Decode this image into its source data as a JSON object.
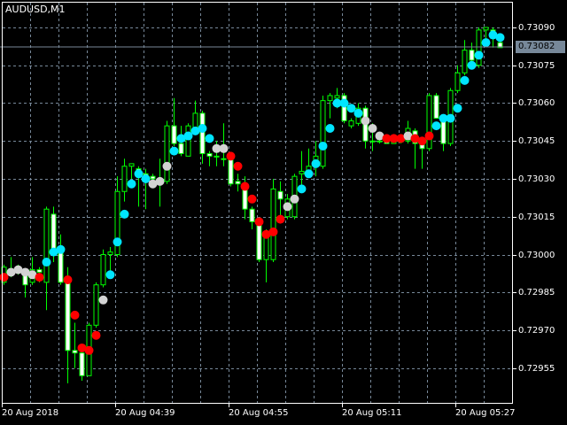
{
  "chart_data": {
    "type": "candlestick",
    "title": "AUDUSD,M1",
    "symbol": "AUDUSD",
    "timeframe": "M1",
    "ylim": [
      0.72935,
      0.731
    ],
    "y_ticks": [
      "0.73090",
      "0.73075",
      "0.73060",
      "0.73045",
      "0.73030",
      "0.73015",
      "0.73000",
      "0.72985",
      "0.72970",
      "0.72955"
    ],
    "x_tick_labels": [
      {
        "bar": 0,
        "label": "20 Aug 2018"
      },
      {
        "bar": 16,
        "label": "20 Aug 04:39"
      },
      {
        "bar": 32,
        "label": "20 Aug 04:55"
      },
      {
        "bar": 48,
        "label": "20 Aug 05:11"
      },
      {
        "bar": 64,
        "label": "20 Aug 05:27"
      }
    ],
    "current_price": "0.73082",
    "grid": true,
    "ohlc": [
      [
        0.72989,
        0.72996,
        0.72988,
        0.72995
      ],
      [
        0.72993,
        0.72999,
        0.72991,
        0.72994
      ],
      [
        0.72994,
        0.72996,
        0.72992,
        0.72993
      ],
      [
        0.72992,
        0.72994,
        0.72983,
        0.72988
      ],
      [
        0.72989,
        0.72999,
        0.72988,
        0.72994
      ],
      [
        0.72994,
        0.72995,
        0.72989,
        0.72993
      ],
      [
        0.72989,
        0.73019,
        0.72978,
        0.73018
      ],
      [
        0.73016,
        0.73019,
        0.72997,
        0.73001
      ],
      [
        0.73001,
        0.73008,
        0.72988,
        0.72989
      ],
      [
        0.7299,
        0.72995,
        0.72949,
        0.72962
      ],
      [
        0.72962,
        0.72973,
        0.72955,
        0.72961
      ],
      [
        0.72961,
        0.72962,
        0.7295,
        0.72952
      ],
      [
        0.72952,
        0.72973,
        0.72952,
        0.72972
      ],
      [
        0.72972,
        0.72989,
        0.72971,
        0.72988
      ],
      [
        0.72988,
        0.73002,
        0.72987,
        0.73
      ],
      [
        0.73,
        0.73003,
        0.72993,
        0.73001
      ],
      [
        0.73,
        0.73031,
        0.72999,
        0.73025
      ],
      [
        0.73025,
        0.73038,
        0.73021,
        0.73035
      ],
      [
        0.73035,
        0.73036,
        0.7303,
        0.73036
      ],
      [
        0.73034,
        0.73035,
        0.73019,
        0.73032
      ],
      [
        0.73032,
        0.73034,
        0.73018,
        0.73031
      ],
      [
        0.73031,
        0.73032,
        0.73028,
        0.7303
      ],
      [
        0.7303,
        0.73038,
        0.73019,
        0.7303
      ],
      [
        0.73029,
        0.73053,
        0.73028,
        0.73051
      ],
      [
        0.73051,
        0.73062,
        0.73043,
        0.73044
      ],
      [
        0.73044,
        0.73051,
        0.73039,
        0.7304
      ],
      [
        0.73039,
        0.73052,
        0.73039,
        0.73051
      ],
      [
        0.73049,
        0.73061,
        0.73048,
        0.73056
      ],
      [
        0.73056,
        0.73057,
        0.73036,
        0.7304
      ],
      [
        0.7304,
        0.73041,
        0.73035,
        0.73039
      ],
      [
        0.73039,
        0.73045,
        0.73035,
        0.73039
      ],
      [
        0.73038,
        0.73052,
        0.73035,
        0.73038
      ],
      [
        0.73039,
        0.7304,
        0.73027,
        0.73028
      ],
      [
        0.73029,
        0.73032,
        0.73025,
        0.73028
      ],
      [
        0.73026,
        0.73031,
        0.73014,
        0.73018
      ],
      [
        0.73018,
        0.73019,
        0.7301,
        0.73013
      ],
      [
        0.73012,
        0.73013,
        0.72997,
        0.72998
      ],
      [
        0.72998,
        0.7301,
        0.72989,
        0.73009
      ],
      [
        0.72998,
        0.7303,
        0.72997,
        0.73026
      ],
      [
        0.73025,
        0.73029,
        0.73014,
        0.73022
      ],
      [
        0.73015,
        0.73024,
        0.73014,
        0.73022
      ],
      [
        0.73015,
        0.73032,
        0.73014,
        0.73031
      ],
      [
        0.73032,
        0.73041,
        0.73026,
        0.73033
      ],
      [
        0.73033,
        0.73042,
        0.73032,
        0.73035
      ],
      [
        0.73036,
        0.73045,
        0.73031,
        0.73039
      ],
      [
        0.73035,
        0.73063,
        0.73034,
        0.73061
      ],
      [
        0.73061,
        0.73064,
        0.73054,
        0.73063
      ],
      [
        0.73062,
        0.73066,
        0.73058,
        0.73063
      ],
      [
        0.73063,
        0.73064,
        0.73052,
        0.73053
      ],
      [
        0.73051,
        0.73054,
        0.7305,
        0.73053
      ],
      [
        0.73052,
        0.7306,
        0.73051,
        0.73058
      ],
      [
        0.73058,
        0.73059,
        0.73042,
        0.73045
      ],
      [
        0.73045,
        0.73052,
        0.73041,
        0.73045
      ],
      [
        0.73045,
        0.73046,
        0.73044,
        0.73045
      ],
      [
        0.73045,
        0.73046,
        0.73044,
        0.73044
      ],
      [
        0.73044,
        0.73045,
        0.73044,
        0.73045
      ],
      [
        0.73045,
        0.73045,
        0.73044,
        0.73045
      ],
      [
        0.73045,
        0.73053,
        0.73044,
        0.7305
      ],
      [
        0.73049,
        0.7305,
        0.73034,
        0.73044
      ],
      [
        0.73044,
        0.73045,
        0.73034,
        0.73042
      ],
      [
        0.73042,
        0.73064,
        0.73041,
        0.73063
      ],
      [
        0.73063,
        0.73064,
        0.73054,
        0.73054
      ],
      [
        0.73054,
        0.73055,
        0.73041,
        0.73044
      ],
      [
        0.73044,
        0.73066,
        0.73043,
        0.73065
      ],
      [
        0.73065,
        0.73075,
        0.73064,
        0.73072
      ],
      [
        0.73072,
        0.73085,
        0.73071,
        0.73081
      ],
      [
        0.73081,
        0.73084,
        0.73075,
        0.73077
      ],
      [
        0.73075,
        0.7309,
        0.73074,
        0.73089
      ],
      [
        0.73089,
        0.7309,
        0.73083,
        0.7309
      ],
      [
        0.73089,
        0.7309,
        0.73082,
        0.73086
      ],
      [
        0.73084,
        0.73085,
        0.73082,
        0.73082
      ]
    ],
    "indicator_dots": [
      [
        0.72991,
        "red"
      ],
      [
        0.72993,
        "silver"
      ],
      [
        0.72994,
        "silver"
      ],
      [
        0.72993,
        "silver"
      ],
      [
        0.72992,
        "silver"
      ],
      [
        0.72991,
        "red"
      ],
      [
        0.72997,
        "cyan"
      ],
      [
        0.73001,
        "cyan"
      ],
      [
        0.73002,
        "cyan"
      ],
      [
        0.7299,
        "red"
      ],
      [
        0.72976,
        "red"
      ],
      [
        0.72963,
        "red"
      ],
      [
        0.72962,
        "red"
      ],
      [
        0.72968,
        "red"
      ],
      [
        0.72982,
        "silver"
      ],
      [
        0.72992,
        "cyan"
      ],
      [
        0.73005,
        "cyan"
      ],
      [
        0.73016,
        "cyan"
      ],
      [
        0.73028,
        "cyan"
      ],
      [
        0.73032,
        "cyan"
      ],
      [
        0.7303,
        "cyan"
      ],
      [
        0.73028,
        "silver"
      ],
      [
        0.73029,
        "silver"
      ],
      [
        0.73035,
        "silver"
      ],
      [
        0.73041,
        "cyan"
      ],
      [
        0.73046,
        "cyan"
      ],
      [
        0.73047,
        "cyan"
      ],
      [
        0.73049,
        "cyan"
      ],
      [
        0.7305,
        "cyan"
      ],
      [
        0.73046,
        "cyan"
      ],
      [
        0.73042,
        "silver"
      ],
      [
        0.73042,
        "silver"
      ],
      [
        0.73039,
        "red"
      ],
      [
        0.73035,
        "red"
      ],
      [
        0.73027,
        "red"
      ],
      [
        0.73022,
        "red"
      ],
      [
        0.73013,
        "red"
      ],
      [
        0.73008,
        "red"
      ],
      [
        0.73009,
        "red"
      ],
      [
        0.73014,
        "red"
      ],
      [
        0.73019,
        "silver"
      ],
      [
        0.73022,
        "silver"
      ],
      [
        0.73026,
        "cyan"
      ],
      [
        0.73032,
        "cyan"
      ],
      [
        0.73036,
        "cyan"
      ],
      [
        0.73043,
        "cyan"
      ],
      [
        0.7305,
        "cyan"
      ],
      [
        0.7306,
        "cyan"
      ],
      [
        0.7306,
        "cyan"
      ],
      [
        0.73058,
        "cyan"
      ],
      [
        0.73056,
        "cyan"
      ],
      [
        0.73053,
        "silver"
      ],
      [
        0.7305,
        "silver"
      ],
      [
        0.73047,
        "silver"
      ],
      [
        0.73046,
        "red"
      ],
      [
        0.73046,
        "red"
      ],
      [
        0.73046,
        "red"
      ],
      [
        0.73047,
        "silver"
      ],
      [
        0.73046,
        "red"
      ],
      [
        0.73045,
        "red"
      ],
      [
        0.73047,
        "red"
      ],
      [
        0.73051,
        "cyan"
      ],
      [
        0.73054,
        "cyan"
      ],
      [
        0.73054,
        "cyan"
      ],
      [
        0.73058,
        "cyan"
      ],
      [
        0.73069,
        "cyan"
      ],
      [
        0.73075,
        "cyan"
      ],
      [
        0.73079,
        "cyan"
      ],
      [
        0.73084,
        "cyan"
      ],
      [
        0.73087,
        "cyan"
      ],
      [
        0.73086,
        "cyan"
      ]
    ],
    "colors": {
      "bull_outline": "#00ff00",
      "bear_fill": "#ffffff",
      "wick": "#00ff00",
      "grid": "#778899",
      "cyan": "#00e5ff",
      "red": "#ff0000",
      "silver": "#d3d3d3",
      "price_line": "#778899"
    }
  }
}
